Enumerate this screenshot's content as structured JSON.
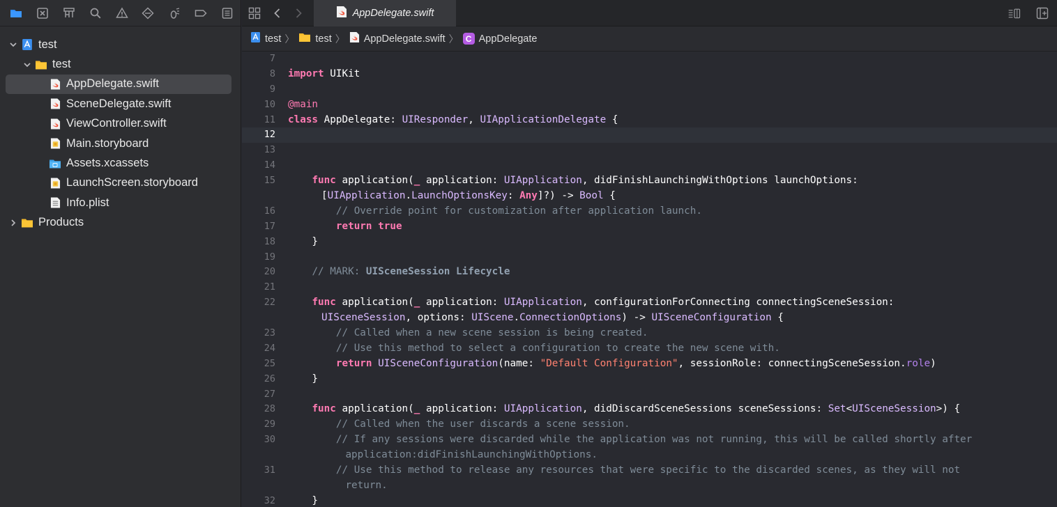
{
  "navigator": {
    "toolbar_icons": [
      "project-navigator-icon",
      "source-control-icon",
      "symbol-navigator-icon",
      "find-icon",
      "issue-icon",
      "test-icon",
      "debug-icon",
      "breakpoint-icon",
      "report-icon"
    ],
    "tree": [
      {
        "label": "test",
        "level": 0,
        "expanded": true,
        "icon": "project-icon",
        "selected": false
      },
      {
        "label": "test",
        "level": 1,
        "expanded": true,
        "icon": "folder-icon",
        "selected": false
      },
      {
        "label": "AppDelegate.swift",
        "level": 2,
        "icon": "swift-file-icon",
        "selected": true
      },
      {
        "label": "SceneDelegate.swift",
        "level": 2,
        "icon": "swift-file-icon",
        "selected": false
      },
      {
        "label": "ViewController.swift",
        "level": 2,
        "icon": "swift-file-icon",
        "selected": false
      },
      {
        "label": "Main.storyboard",
        "level": 2,
        "icon": "storyboard-icon",
        "selected": false
      },
      {
        "label": "Assets.xcassets",
        "level": 2,
        "icon": "assets-icon",
        "selected": false
      },
      {
        "label": "LaunchScreen.storyboard",
        "level": 2,
        "icon": "storyboard-icon",
        "selected": false
      },
      {
        "label": "Info.plist",
        "level": 2,
        "icon": "plist-icon",
        "selected": false
      },
      {
        "label": "Products",
        "level": 0,
        "expanded": false,
        "icon": "folder-icon",
        "selected": false
      }
    ]
  },
  "tab": {
    "label": "AppDelegate.swift"
  },
  "breadcrumb": {
    "project": "test",
    "group": "test",
    "file": "AppDelegate.swift",
    "symbol": "AppDelegate",
    "symbol_badge": "C"
  },
  "code": {
    "current_line": 12,
    "lines": [
      {
        "n": "7",
        "segs": []
      },
      {
        "n": "8",
        "segs": [
          [
            "kw",
            "import"
          ],
          [
            "pl",
            " UIKit"
          ]
        ]
      },
      {
        "n": "9",
        "segs": []
      },
      {
        "n": "10",
        "segs": [
          [
            "at",
            "@main"
          ]
        ]
      },
      {
        "n": "11",
        "segs": [
          [
            "kw",
            "class"
          ],
          [
            "pl",
            " AppDelegate: "
          ],
          [
            "ty",
            "UIResponder"
          ],
          [
            "pl",
            ", "
          ],
          [
            "ty",
            "UIApplicationDelegate"
          ],
          [
            "pl",
            " {"
          ]
        ]
      },
      {
        "n": "12",
        "segs": []
      },
      {
        "n": "13",
        "segs": []
      },
      {
        "n": "14",
        "segs": []
      },
      {
        "n": "15",
        "segs": [
          [
            "pl",
            "    "
          ],
          [
            "kw",
            "func"
          ],
          [
            "pl",
            " application("
          ],
          [
            "kw",
            "_"
          ],
          [
            "pl",
            " application: "
          ],
          [
            "ty",
            "UIApplication"
          ],
          [
            "pl",
            ", didFinishLaunchingWithOptions launchOptions:"
          ]
        ]
      },
      {
        "n": "",
        "cont": true,
        "segs": [
          [
            "pl",
            "["
          ],
          [
            "ty",
            "UIApplication"
          ],
          [
            "pl",
            "."
          ],
          [
            "ty",
            "LaunchOptionsKey"
          ],
          [
            "pl",
            ": "
          ],
          [
            "kw",
            "Any"
          ],
          [
            "pl",
            "]?) -> "
          ],
          [
            "ty",
            "Bool"
          ],
          [
            "pl",
            " {"
          ]
        ]
      },
      {
        "n": "16",
        "segs": [
          [
            "pl",
            "        "
          ],
          [
            "cm",
            "// Override point for customization after application launch."
          ]
        ]
      },
      {
        "n": "17",
        "segs": [
          [
            "pl",
            "        "
          ],
          [
            "kw",
            "return"
          ],
          [
            "pl",
            " "
          ],
          [
            "kw",
            "true"
          ]
        ]
      },
      {
        "n": "18",
        "segs": [
          [
            "pl",
            "    }"
          ]
        ]
      },
      {
        "n": "19",
        "segs": []
      },
      {
        "n": "20",
        "segs": [
          [
            "pl",
            "    "
          ],
          [
            "cm",
            "// MARK: "
          ],
          [
            "mk",
            "UISceneSession Lifecycle"
          ]
        ]
      },
      {
        "n": "21",
        "segs": []
      },
      {
        "n": "22",
        "segs": [
          [
            "pl",
            "    "
          ],
          [
            "kw",
            "func"
          ],
          [
            "pl",
            " application("
          ],
          [
            "kw",
            "_"
          ],
          [
            "pl",
            " application: "
          ],
          [
            "ty",
            "UIApplication"
          ],
          [
            "pl",
            ", configurationForConnecting connectingSceneSession:"
          ]
        ]
      },
      {
        "n": "",
        "cont": true,
        "segs": [
          [
            "ty",
            "UISceneSession"
          ],
          [
            "pl",
            ", options: "
          ],
          [
            "ty",
            "UIScene"
          ],
          [
            "pl",
            "."
          ],
          [
            "ty",
            "ConnectionOptions"
          ],
          [
            "pl",
            ") -> "
          ],
          [
            "ty",
            "UISceneConfiguration"
          ],
          [
            "pl",
            " {"
          ]
        ]
      },
      {
        "n": "23",
        "segs": [
          [
            "pl",
            "        "
          ],
          [
            "cm",
            "// Called when a new scene session is being created."
          ]
        ]
      },
      {
        "n": "24",
        "segs": [
          [
            "pl",
            "        "
          ],
          [
            "cm",
            "// Use this method to select a configuration to create the new scene with."
          ]
        ]
      },
      {
        "n": "25",
        "segs": [
          [
            "pl",
            "        "
          ],
          [
            "kw",
            "return"
          ],
          [
            "pl",
            " "
          ],
          [
            "ty",
            "UISceneConfiguration"
          ],
          [
            "pl",
            "(name: "
          ],
          [
            "st",
            "\"Default Configuration\""
          ],
          [
            "pl",
            ", sessionRole: connectingSceneSession."
          ],
          [
            "pr",
            "role"
          ],
          [
            "pl",
            ")"
          ]
        ]
      },
      {
        "n": "26",
        "segs": [
          [
            "pl",
            "    }"
          ]
        ]
      },
      {
        "n": "27",
        "segs": []
      },
      {
        "n": "28",
        "segs": [
          [
            "pl",
            "    "
          ],
          [
            "kw",
            "func"
          ],
          [
            "pl",
            " application("
          ],
          [
            "kw",
            "_"
          ],
          [
            "pl",
            " application: "
          ],
          [
            "ty",
            "UIApplication"
          ],
          [
            "pl",
            ", didDiscardSceneSessions sceneSessions: "
          ],
          [
            "ty",
            "Set"
          ],
          [
            "pl",
            "<"
          ],
          [
            "ty",
            "UISceneSession"
          ],
          [
            "pl",
            ">) {"
          ]
        ]
      },
      {
        "n": "29",
        "segs": [
          [
            "pl",
            "        "
          ],
          [
            "cm",
            "// Called when the user discards a scene session."
          ]
        ]
      },
      {
        "n": "30",
        "segs": [
          [
            "pl",
            "        "
          ],
          [
            "cm",
            "// If any sessions were discarded while the application was not running, this will be called shortly after"
          ]
        ]
      },
      {
        "n": "",
        "cont": true,
        "segs": [
          [
            "pl",
            "    "
          ],
          [
            "cm",
            "application:didFinishLaunchingWithOptions."
          ]
        ]
      },
      {
        "n": "31",
        "segs": [
          [
            "pl",
            "        "
          ],
          [
            "cm",
            "// Use this method to release any resources that were specific to the discarded scenes, as they will not"
          ]
        ]
      },
      {
        "n": "",
        "cont": true,
        "segs": [
          [
            "pl",
            "    "
          ],
          [
            "cm",
            "return."
          ]
        ]
      },
      {
        "n": "32",
        "segs": [
          [
            "pl",
            "    }"
          ]
        ]
      }
    ]
  }
}
